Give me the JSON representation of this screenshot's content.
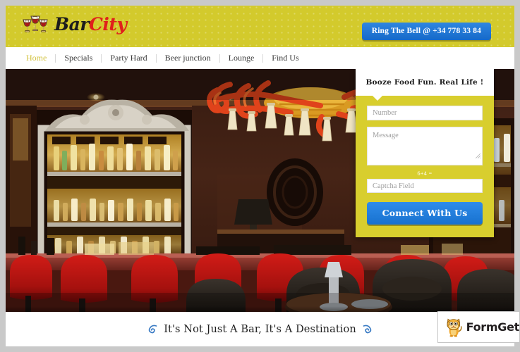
{
  "site": {
    "logo": {
      "part1": "Bar",
      "part2": "City",
      "icon": "wine-glasses-icon",
      "colors": {
        "part1": "#1c1c1c",
        "part2": "#e0201b"
      }
    },
    "header": {
      "background_color": "#d3ca2c",
      "cta": {
        "label": "Ring The Bell @ +34 778 33 84",
        "color": "#1b78d8"
      }
    },
    "nav": {
      "items": [
        {
          "label": "Home",
          "active": true
        },
        {
          "label": "Specials",
          "active": false
        },
        {
          "label": "Party Hard",
          "active": false
        },
        {
          "label": "Beer junction",
          "active": false
        },
        {
          "label": "Lounge",
          "active": false
        },
        {
          "label": "Find Us",
          "active": false
        }
      ],
      "active_color": "#d3c341"
    }
  },
  "hero": {
    "description": "Interior photograph of an upscale bar: ornate illuminated liquor shelf with bottles, a large red and gold chandelier with cream tassels, dark wood paneling, red velvet bar stools along a wooden counter and dark leather lounge chairs in the foreground."
  },
  "contact_form": {
    "heading": "Booze Food Fun. Real Life !",
    "panel_color": "#d8ce2e",
    "fields": {
      "number": {
        "placeholder": "Number",
        "value": ""
      },
      "message": {
        "placeholder": "Message",
        "value": ""
      },
      "captcha": {
        "placeholder": "Captcha Field",
        "value": ""
      }
    },
    "captcha_question": "6+4 =",
    "submit": {
      "label": "Connect With Us",
      "color": "#1f7fdd"
    }
  },
  "footer": {
    "tagline": "It's Not Just A Bar, It's A Destination",
    "ornament_left": "swirl-ornament-icon",
    "ornament_right": "swirl-ornament-icon",
    "ornament_color": "#2f6fb5"
  },
  "badge": {
    "brand": "FormGet",
    "mascot": "cat-mascot-icon"
  }
}
